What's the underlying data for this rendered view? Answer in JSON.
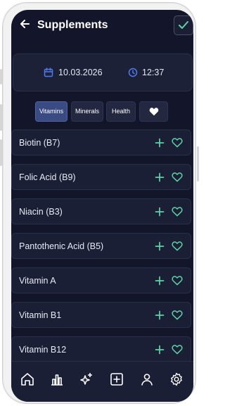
{
  "header": {
    "title": "Supplements"
  },
  "datetime": {
    "date": "10.03.2026",
    "time": "12:37"
  },
  "tabs": [
    {
      "label": "Vitamins",
      "active": true
    },
    {
      "label": "Minerals",
      "active": false
    },
    {
      "label": "Health",
      "active": false
    },
    {
      "icon": "heart-icon",
      "active": false
    }
  ],
  "supplements": [
    {
      "name": "Biotin (B7)"
    },
    {
      "name": "Folic Acid (B9)"
    },
    {
      "name": "Niacin (B3)"
    },
    {
      "name": "Pantothenic Acid (B5)"
    },
    {
      "name": "Vitamin A"
    },
    {
      "name": "Vitamin B1"
    },
    {
      "name": "Vitamin B12"
    }
  ],
  "nav": [
    {
      "icon": "home-icon"
    },
    {
      "icon": "bar-chart-icon"
    },
    {
      "icon": "sparkles-icon"
    },
    {
      "icon": "plus-square-icon"
    },
    {
      "icon": "user-icon"
    },
    {
      "icon": "settings-icon"
    }
  ],
  "colors": {
    "background": "#13162b",
    "card": "#1b1f36",
    "accent_blue": "#4f7bf0",
    "accent_green": "#5fd3a6",
    "tab_active": "#3a4a82"
  }
}
